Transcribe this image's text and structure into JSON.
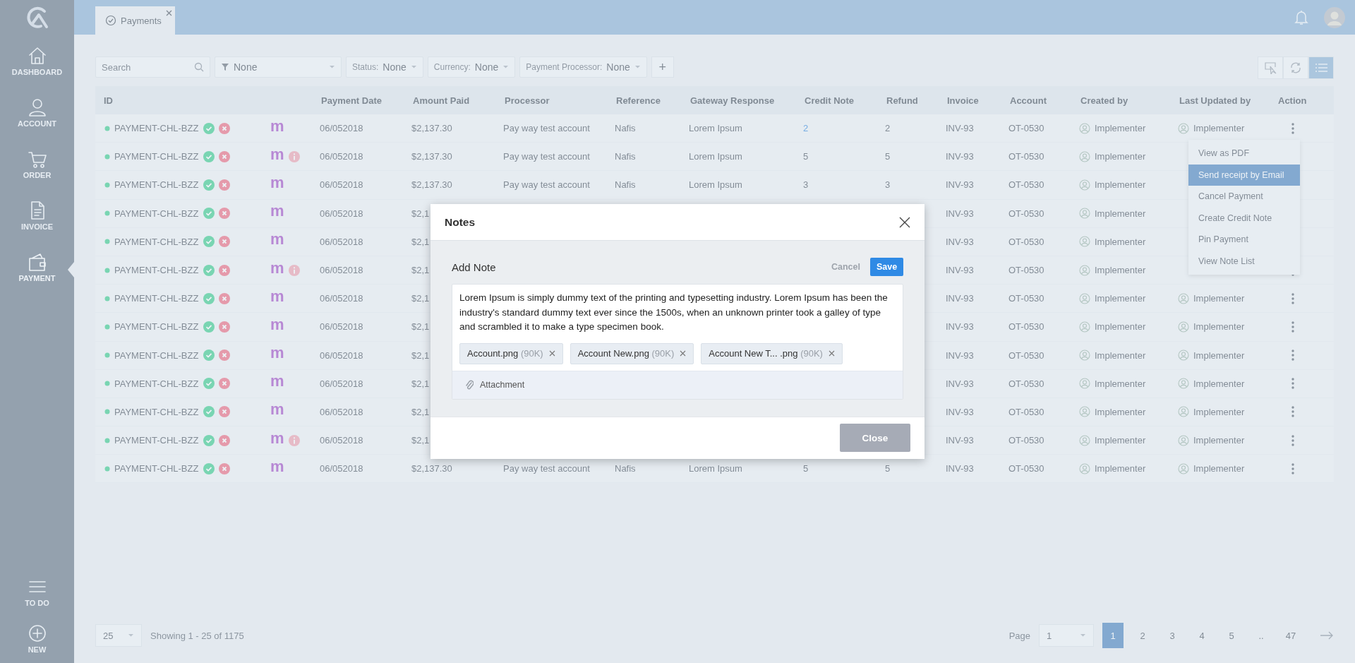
{
  "sidebar": {
    "items": [
      {
        "label": "DASHBOARD",
        "kind": "home",
        "selected": false
      },
      {
        "label": "ACCOUNT",
        "kind": "person",
        "selected": false
      },
      {
        "label": "ORDER",
        "kind": "cart",
        "selected": false
      },
      {
        "label": "INVOICE",
        "kind": "document",
        "selected": false
      },
      {
        "label": "PAYMENT",
        "kind": "wallet",
        "selected": true
      }
    ],
    "bottom_items": [
      {
        "label": "TO DO",
        "kind": "list"
      },
      {
        "label": "NEW",
        "kind": "plus"
      }
    ]
  },
  "tabs": [
    {
      "label": "Payments",
      "selected": true
    }
  ],
  "filters": {
    "search": {
      "placeholder": "Search"
    },
    "items": [
      {
        "kind": "funnel",
        "value": "None"
      },
      {
        "kind": "labeled",
        "label": "Status:",
        "value": "None"
      },
      {
        "kind": "labeled",
        "label": "Currency:",
        "value": "None"
      },
      {
        "kind": "labeled",
        "label": "Payment Processor:",
        "value": "None"
      }
    ],
    "add": "+"
  },
  "view_buttons": [
    {
      "kind": "select",
      "selected": false
    },
    {
      "kind": "refresh",
      "selected": false
    },
    {
      "kind": "list",
      "selected": true
    }
  ],
  "table": {
    "columns": [
      "ID",
      "Payment Date",
      "Amount Paid",
      "Processor",
      "Reference",
      "Gateway Response",
      "Credit Note",
      "Refund",
      "Invoice",
      "Account",
      "Created by",
      "Last Updated by",
      "Action"
    ],
    "rows": [
      {
        "id": "PAYMENT-CHL-BZZ",
        "logo": "m",
        "info": false,
        "date": "06/052018",
        "amount": "$2,137.30",
        "processor": "Pay way test account",
        "reference": "Nafis",
        "gateway": "Lorem Ipsum",
        "credit_note": "2",
        "credit_note_link": true,
        "refund": "2",
        "invoice": "INV-93",
        "account": "OT-0530",
        "created_by": "Implementer",
        "last_updated_by": "Implementer"
      },
      {
        "id": "PAYMENT-CHL-BZZ",
        "logo": "m",
        "info": true,
        "date": "06/052018",
        "amount": "$2,137.30",
        "processor": "Pay way test account",
        "reference": "Nafis",
        "gateway": "Lorem Ipsum",
        "credit_note": "5",
        "credit_note_link": false,
        "refund": "5",
        "invoice": "INV-93",
        "account": "OT-0530",
        "created_by": "Implementer"
      },
      {
        "id": "PAYMENT-CHL-BZZ",
        "logo": "m",
        "info": false,
        "date": "06/052018",
        "amount": "$2,137.30",
        "processor": "Pay way test account",
        "reference": "Nafis",
        "gateway": "Lorem Ipsum",
        "credit_note": "3",
        "credit_note_link": false,
        "refund": "3",
        "invoice": "INV-93",
        "account": "OT-0530",
        "created_by": "Implementer"
      },
      {
        "id": "PAYMENT-CHL-BZZ",
        "logo": "m",
        "info": false,
        "date": "06/052018",
        "amount": "$2,1",
        "invoice": "INV-93",
        "account": "OT-0530",
        "created_by": "Implementer"
      },
      {
        "id": "PAYMENT-CHL-BZZ",
        "logo": "m",
        "info": false,
        "date": "06/052018",
        "amount": "$2,1",
        "invoice": "INV-93",
        "account": "OT-0530",
        "created_by": "Implementer"
      },
      {
        "id": "PAYMENT-CHL-BZZ",
        "logo": "m",
        "info": true,
        "date": "06/052018",
        "amount": "$2,1",
        "invoice": "INV-93",
        "account": "OT-0530",
        "created_by": "Implementer"
      },
      {
        "id": "PAYMENT-CHL-BZZ",
        "logo": "m",
        "info": false,
        "date": "06/052018",
        "amount": "$2,1",
        "invoice": "INV-93",
        "account": "OT-0530",
        "created_by": "Implementer",
        "last_updated_by": "Implementer"
      },
      {
        "id": "PAYMENT-CHL-BZZ",
        "logo": "m",
        "info": false,
        "date": "06/052018",
        "amount": "$2,1",
        "invoice": "INV-93",
        "account": "OT-0530",
        "created_by": "Implementer",
        "last_updated_by": "Implementer"
      },
      {
        "id": "PAYMENT-CHL-BZZ",
        "logo": "m",
        "info": false,
        "date": "06/052018",
        "amount": "$2,1",
        "invoice": "INV-93",
        "account": "OT-0530",
        "created_by": "Implementer",
        "last_updated_by": "Implementer"
      },
      {
        "id": "PAYMENT-CHL-BZZ",
        "logo": "m",
        "info": false,
        "date": "06/052018",
        "amount": "$2,1",
        "invoice": "INV-93",
        "account": "OT-0530",
        "created_by": "Implementer",
        "last_updated_by": "Implementer"
      },
      {
        "id": "PAYMENT-CHL-BZZ",
        "logo": "m",
        "info": false,
        "date": "06/052018",
        "amount": "$2,1",
        "invoice": "INV-93",
        "account": "OT-0530",
        "created_by": "Implementer",
        "last_updated_by": "Implementer"
      },
      {
        "id": "PAYMENT-CHL-BZZ",
        "logo": "m",
        "info": true,
        "date": "06/052018",
        "amount": "$2,1",
        "invoice": "INV-93",
        "account": "OT-0530",
        "created_by": "Implementer",
        "last_updated_by": "Implementer"
      },
      {
        "id": "PAYMENT-CHL-BZZ",
        "logo": "m",
        "info": false,
        "date": "06/052018",
        "amount": "$2,137.30",
        "processor": "Pay way test account",
        "reference": "Nafis",
        "gateway": "Lorem Ipsum",
        "credit_note": "5",
        "credit_note_link": false,
        "refund": "5",
        "invoice": "INV-93",
        "account": "OT-0530",
        "created_by": "Implementer",
        "last_updated_by": "Implementer"
      }
    ]
  },
  "row_menu": {
    "items": [
      {
        "label": "View as PDF",
        "selected": false
      },
      {
        "label": "Send receipt by Email",
        "selected": true
      },
      {
        "label": "Cancel Payment",
        "selected": false
      },
      {
        "label": "Create Credit Note",
        "selected": false
      },
      {
        "label": "Pin Payment",
        "selected": false
      },
      {
        "label": "View Note List",
        "selected": false
      }
    ]
  },
  "pagination": {
    "page_size": "25",
    "summary": "Showing 1 - 25 of 1175",
    "page_label": "Page",
    "page_select": "1",
    "pages": [
      {
        "label": "1",
        "selected": true
      },
      {
        "label": "2",
        "selected": false
      },
      {
        "label": "3",
        "selected": false
      },
      {
        "label": "4",
        "selected": false
      },
      {
        "label": "5",
        "selected": false
      },
      {
        "label": "..",
        "selected": false
      },
      {
        "label": "47",
        "selected": false
      }
    ]
  },
  "modal": {
    "title": "Notes",
    "section_title": "Add Note",
    "cancel": "Cancel",
    "save": "Save",
    "note": "Lorem Ipsum is simply dummy text of the printing and typesetting industry. Lorem Ipsum has been the industry's standard dummy text ever since the 1500s, when an unknown printer took a galley of type and scrambled it to make a type specimen book.",
    "attachments": [
      {
        "name": "Account.png",
        "size": "(90K)"
      },
      {
        "name": "Account New.png",
        "size": "(90K)"
      },
      {
        "name": "Account New T... .png",
        "size": "(90K)"
      }
    ],
    "attach_label": "Attachment",
    "close": "Close"
  }
}
